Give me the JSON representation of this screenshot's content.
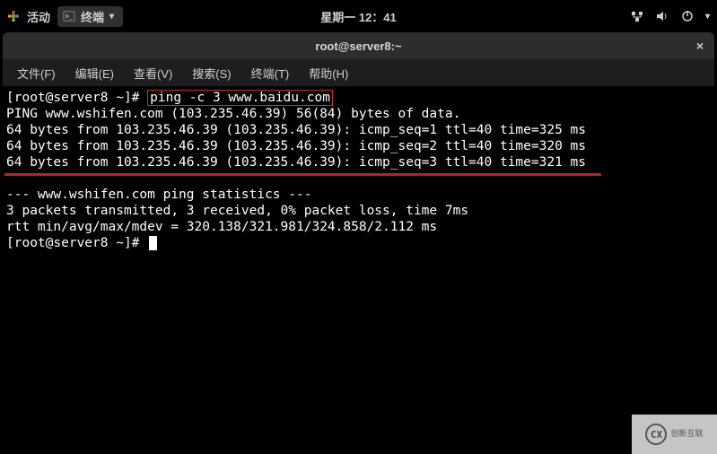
{
  "topbar": {
    "activities": "活动",
    "app_name": "终端",
    "clock": "星期一 12：41"
  },
  "window": {
    "title": "root@server8:~",
    "close": "×"
  },
  "menu": {
    "file": "文件(F)",
    "edit": "编辑(E)",
    "view": "查看(V)",
    "search": "搜索(S)",
    "terminal": "终端(T)",
    "help": "帮助(H)"
  },
  "terminal": {
    "prompt1_user": "[root@server8 ~]# ",
    "command": "ping -c 3 www.baidu.com",
    "line_ping_header": "PING www.wshifen.com (103.235.46.39) 56(84) bytes of data.",
    "line_reply1": "64 bytes from 103.235.46.39 (103.235.46.39): icmp_seq=1 ttl=40 time=325 ms",
    "line_reply2": "64 bytes from 103.235.46.39 (103.235.46.39): icmp_seq=2 ttl=40 time=320 ms",
    "line_reply3": "64 bytes from 103.235.46.39 (103.235.46.39): icmp_seq=3 ttl=40 time=321 ms",
    "line_stats_header": "--- www.wshifen.com ping statistics ---",
    "line_stats1": "3 packets transmitted, 3 received, 0% packet loss, time 7ms",
    "line_stats2": "rtt min/avg/max/mdev = 320.138/321.981/324.858/2.112 ms",
    "prompt2": "[root@server8 ~]# "
  },
  "watermark": {
    "logo": "CX",
    "text": "创新互联"
  }
}
